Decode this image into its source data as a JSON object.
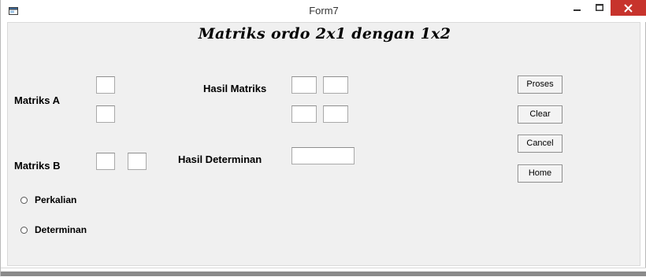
{
  "window": {
    "title": "Form7",
    "controls": {
      "minimize": "minimize",
      "maximize": "maximize",
      "close": "close"
    }
  },
  "form": {
    "heading": "Matriks ordo 2x1 dengan 1x2",
    "labels": {
      "matriks_a": "Matriks A",
      "matriks_b": "Matriks B",
      "hasil_matriks": "Hasil Matriks",
      "hasil_determinan": "Hasil Determinan"
    },
    "inputs": {
      "a1": "",
      "a2": "",
      "b1": "",
      "b2": "",
      "h11": "",
      "h12": "",
      "h21": "",
      "h22": "",
      "determinan": ""
    },
    "options": [
      {
        "label": "Perkalian",
        "selected": false
      },
      {
        "label": "Determinan",
        "selected": false
      }
    ],
    "buttons": {
      "proses": "Proses",
      "clear": "Clear",
      "cancel": "Cancel",
      "home": "Home"
    }
  },
  "colors": {
    "client_bg": "#f0f0f0",
    "close_button": "#c7332c",
    "titlebar": "#ffffff"
  }
}
